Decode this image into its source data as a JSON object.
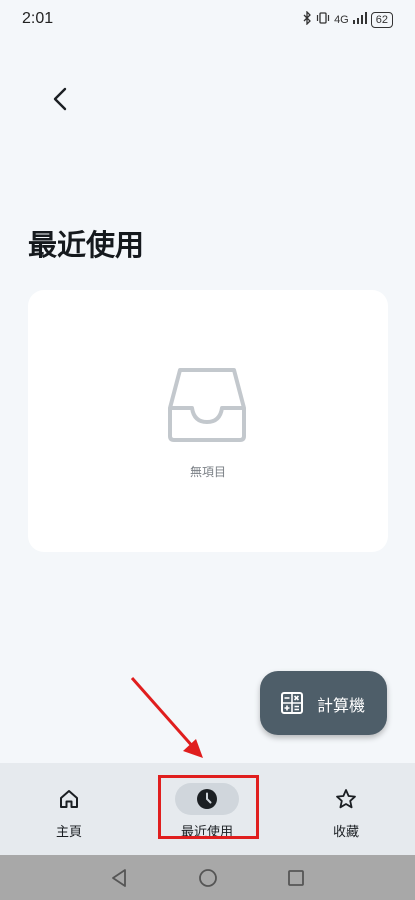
{
  "status_bar": {
    "time": "2:01",
    "network": "4G",
    "battery": "62"
  },
  "header": {
    "back_icon": "chevron-left-icon"
  },
  "page": {
    "title": "最近使用"
  },
  "empty_state": {
    "icon": "inbox-tray-icon",
    "label": "無項目"
  },
  "fab": {
    "icon": "calculator-icon",
    "label": "計算機"
  },
  "bottom_nav": {
    "items": [
      {
        "label": "主頁",
        "icon": "home-icon",
        "active": false
      },
      {
        "label": "最近使用",
        "icon": "clock-icon",
        "active": true
      },
      {
        "label": "收藏",
        "icon": "star-icon",
        "active": false
      }
    ]
  },
  "system_nav": {
    "back": "triangle-back-icon",
    "home": "circle-home-icon",
    "recents": "square-recents-icon"
  },
  "colors": {
    "background": "#f4f7fa",
    "fab": "#4e5e69",
    "nav_bar": "#e6eaee",
    "active_pill": "#d0d6dc",
    "highlight": "#e01e1e"
  }
}
